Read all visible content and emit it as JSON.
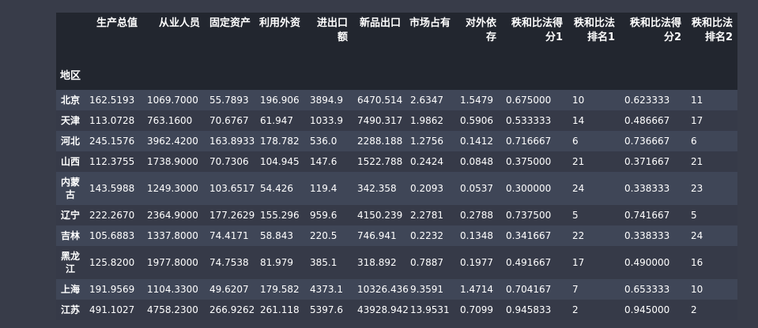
{
  "table": {
    "index_name": "地区",
    "columns": [
      "生产总值",
      "从业人员",
      "固定资产",
      "利用外资",
      "进出口额",
      "新品出口",
      "市场占有",
      "对外依存",
      "秩和比法得分1",
      "秩和比法排名1",
      "秩和比法得分2",
      "秩和比法排名2"
    ],
    "rows": [
      {
        "region": "北京",
        "values": [
          "162.5193",
          "1069.7000",
          "55.7893",
          "196.906",
          "3894.9",
          "6470.514",
          "2.6347",
          "1.5479",
          "0.675000",
          "10",
          "0.623333",
          "11"
        ]
      },
      {
        "region": "天津",
        "values": [
          "113.0728",
          "763.1600",
          "70.6767",
          "61.947",
          "1033.9",
          "7490.317",
          "1.9862",
          "0.5906",
          "0.533333",
          "14",
          "0.486667",
          "17"
        ]
      },
      {
        "region": "河北",
        "values": [
          "245.1576",
          "3962.4200",
          "163.8933",
          "178.782",
          "536.0",
          "2288.188",
          "1.2756",
          "0.1412",
          "0.716667",
          "6",
          "0.736667",
          "6"
        ]
      },
      {
        "region": "山西",
        "values": [
          "112.3755",
          "1738.9000",
          "70.7306",
          "104.945",
          "147.6",
          "1522.788",
          "0.2424",
          "0.0848",
          "0.375000",
          "21",
          "0.371667",
          "21"
        ]
      },
      {
        "region": "内蒙古",
        "values": [
          "143.5988",
          "1249.3000",
          "103.6517",
          "54.426",
          "119.4",
          "342.358",
          "0.2093",
          "0.0537",
          "0.300000",
          "24",
          "0.338333",
          "23"
        ]
      },
      {
        "region": "辽宁",
        "values": [
          "222.2670",
          "2364.9000",
          "177.2629",
          "155.296",
          "959.6",
          "4150.239",
          "2.2781",
          "0.2788",
          "0.737500",
          "5",
          "0.741667",
          "5"
        ]
      },
      {
        "region": "吉林",
        "values": [
          "105.6883",
          "1337.8000",
          "74.4171",
          "58.843",
          "220.5",
          "746.941",
          "0.2232",
          "0.1348",
          "0.341667",
          "22",
          "0.338333",
          "24"
        ]
      },
      {
        "region": "黑龙江",
        "values": [
          "125.8200",
          "1977.8000",
          "74.7538",
          "81.979",
          "385.1",
          "318.892",
          "0.7887",
          "0.1977",
          "0.491667",
          "17",
          "0.490000",
          "16"
        ]
      },
      {
        "region": "上海",
        "values": [
          "191.9569",
          "1104.3300",
          "49.6207",
          "179.582",
          "4373.1",
          "10326.436",
          "9.3591",
          "1.4714",
          "0.704167",
          "7",
          "0.653333",
          "10"
        ]
      },
      {
        "region": "江苏",
        "values": [
          "491.1027",
          "4758.2300",
          "266.9262",
          "261.118",
          "5397.6",
          "43928.942",
          "13.9531",
          "0.7099",
          "0.945833",
          "2",
          "0.945000",
          "2"
        ]
      }
    ]
  },
  "colors": {
    "page_background": "#383c49",
    "header_background": "#22262f",
    "row_odd": "#3f4657",
    "row_even": "#363a48",
    "text": "#ffffff"
  }
}
